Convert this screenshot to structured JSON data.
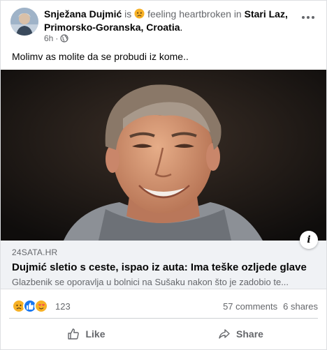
{
  "post": {
    "author": "Snježana Dujmić",
    "is_word": "is",
    "feeling_text": "feeling heartbroken in",
    "location_line1": "Stari Laz,",
    "location_line2": "Primorsko-Goranska, Croatia",
    "location_end": ".",
    "time": "6h",
    "separator": "·",
    "message": "Molimv as molite da se probudi iz kome.."
  },
  "link": {
    "domain": "24SATA.HR",
    "title": "Dujmić sletio s ceste, ispao iz auta: Ima teške ozljede glave",
    "description": "Glazbenik se oporavlja u bolnici na Sušaku nakon što je zadobio te..."
  },
  "engagement": {
    "reaction_count": "123",
    "comments": "57 comments",
    "shares": "6 shares"
  },
  "actions": {
    "like_label": "Like",
    "share_label": "Share"
  },
  "icons": {
    "feeling": "sad-face-icon",
    "audience": "globe-icon",
    "more": "more-options-icon",
    "info": "info-icon",
    "reactions": [
      "sad-reaction-icon",
      "like-reaction-icon",
      "love-reaction-icon"
    ],
    "like": "thumbs-up-icon",
    "share": "share-arrow-icon"
  },
  "colors": {
    "muted_text": "#65676b",
    "like_blue": "#1877f2",
    "sad_yellow": "#f7b125",
    "link_background": "#f0f2f5"
  }
}
